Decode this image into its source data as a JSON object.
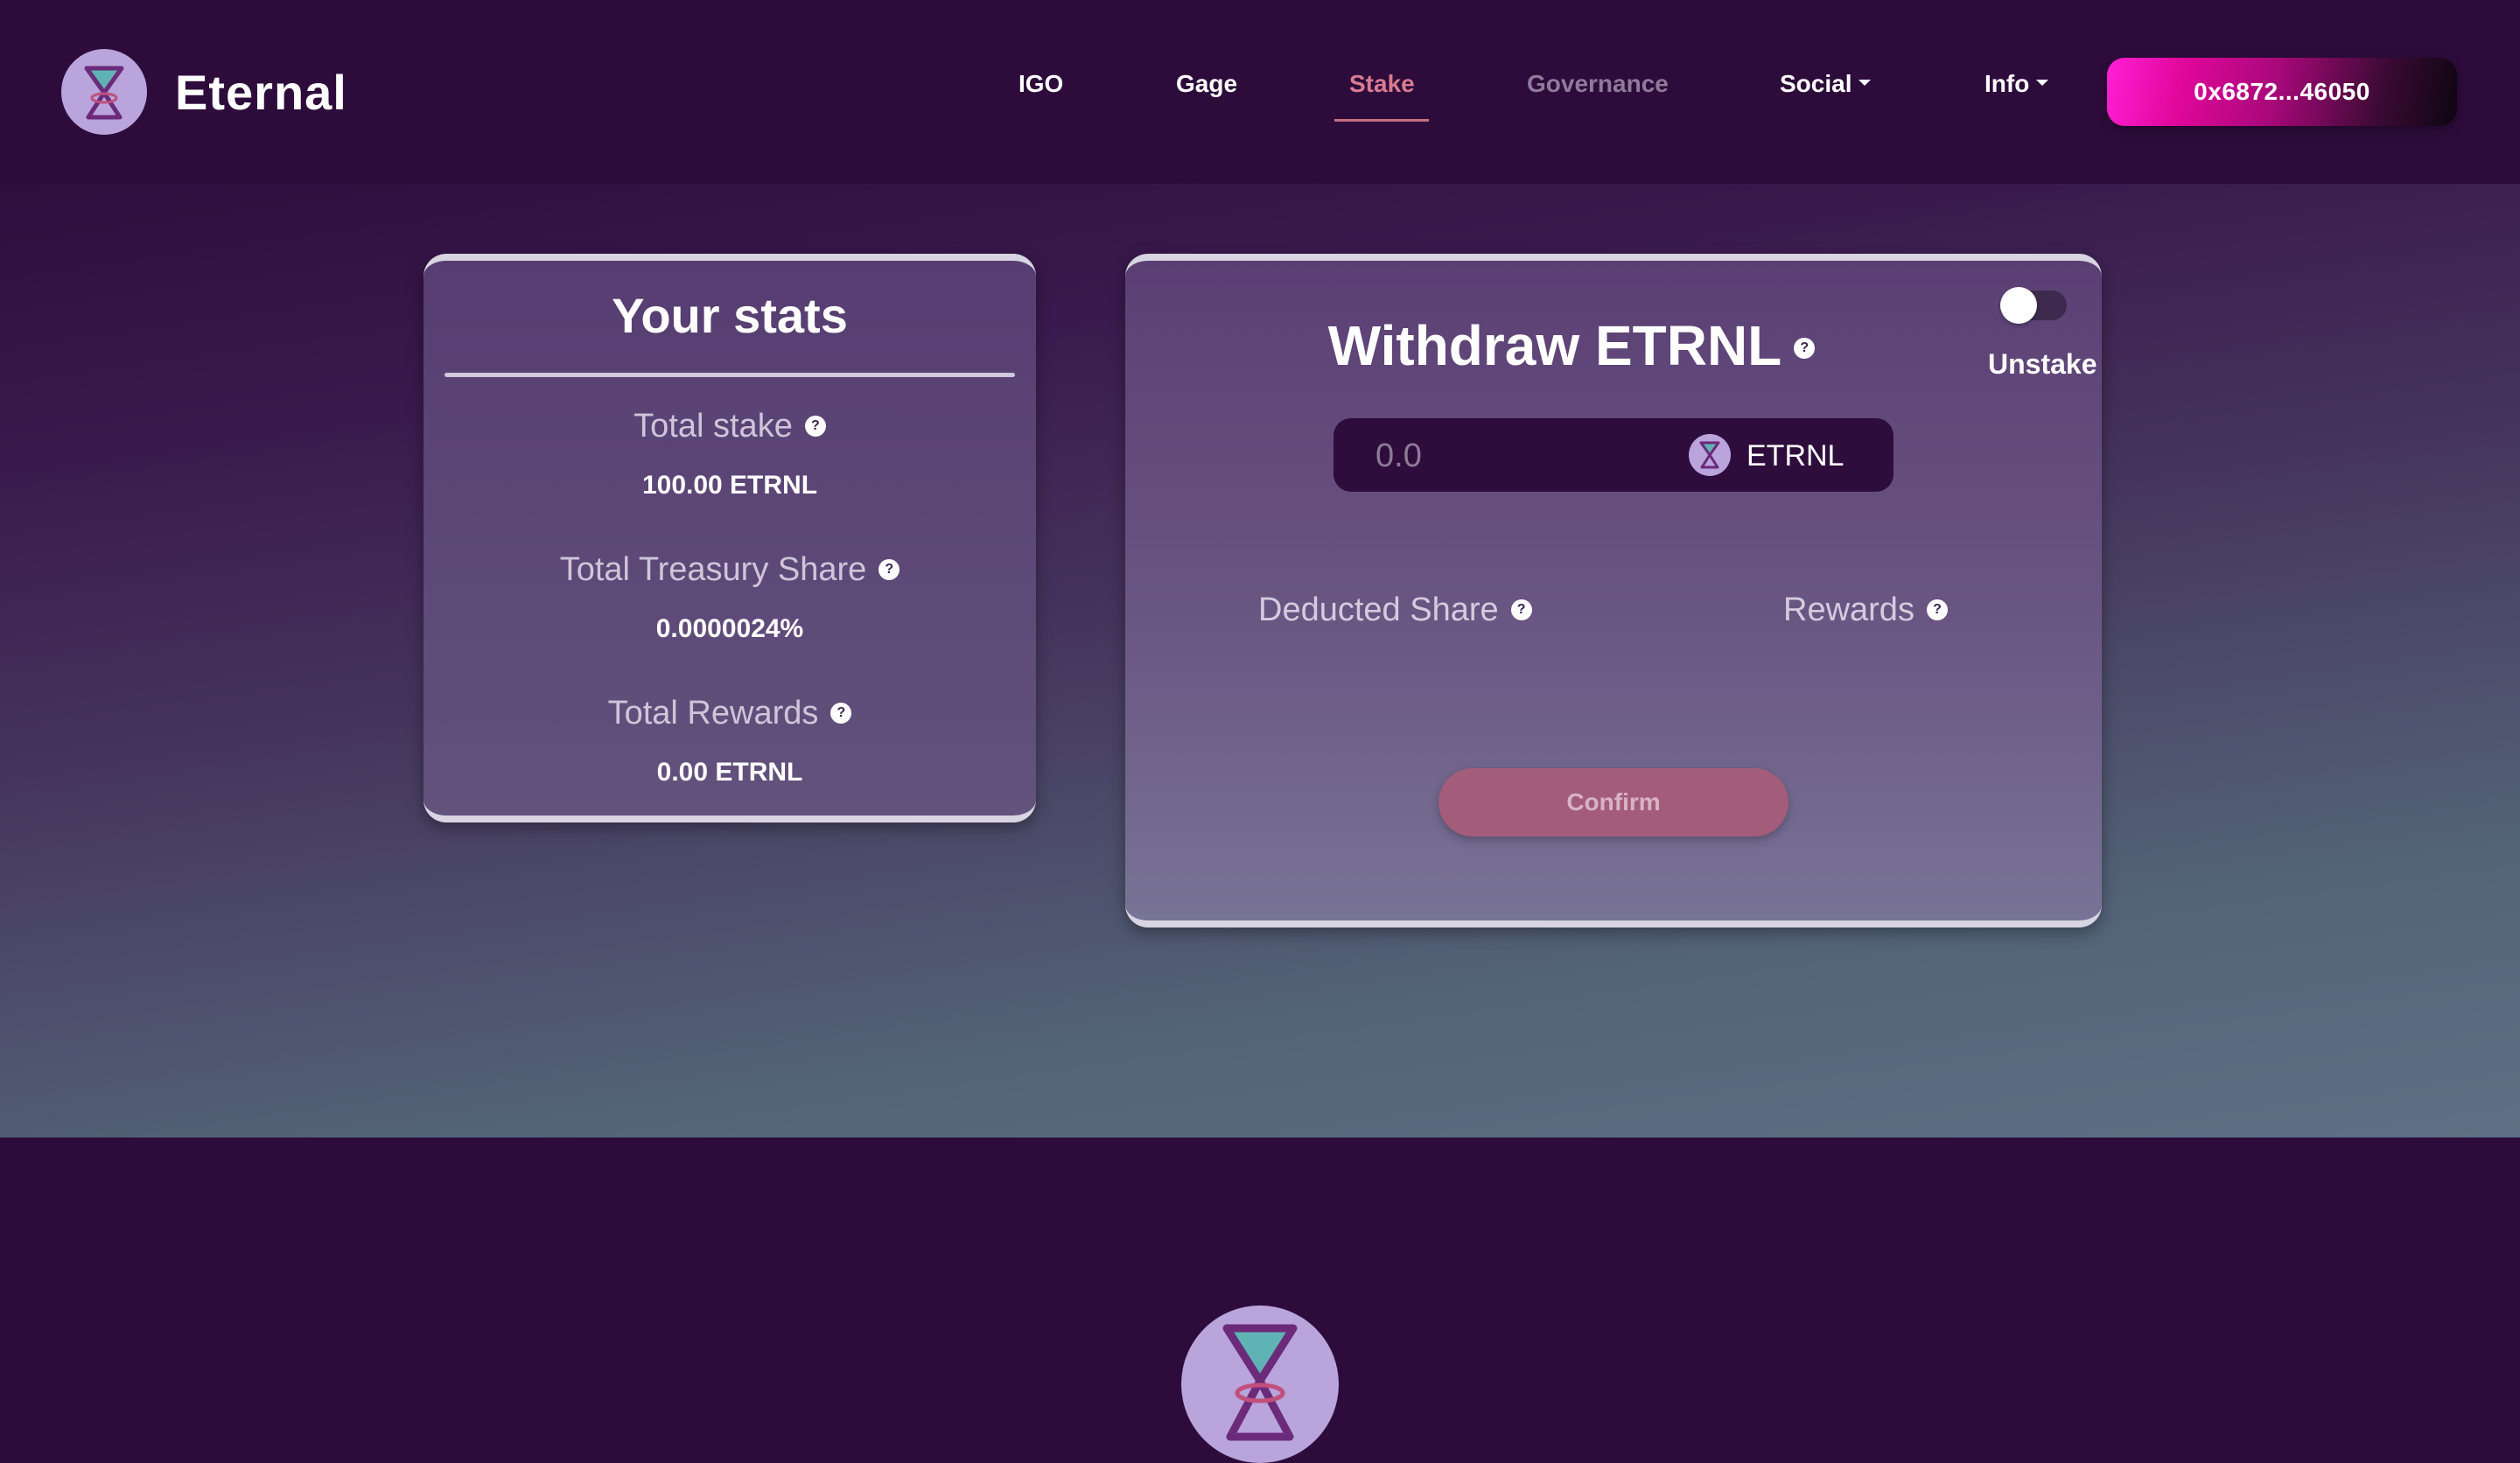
{
  "header": {
    "brand": "Eternal",
    "logo_icon": "hourglass-logo-icon",
    "nav": [
      {
        "label": "IGO"
      },
      {
        "label": "Gage"
      },
      {
        "label": "Stake",
        "active": true
      },
      {
        "label": "Governance",
        "muted": true
      },
      {
        "label": "Social",
        "has_dropdown": true
      },
      {
        "label": "Info",
        "has_dropdown": true
      }
    ],
    "wallet_address": "0x6872...46050"
  },
  "stats_card": {
    "title": "Your stats",
    "items": [
      {
        "label": "Total stake",
        "value": "100.00 ETRNL"
      },
      {
        "label": "Total Treasury Share",
        "value": "0.0000024%"
      },
      {
        "label": "Total Rewards",
        "value": "0.00 ETRNL"
      }
    ],
    "help_icon_text": "?"
  },
  "withdraw_card": {
    "title": "Withdraw ETRNL",
    "toggle_label": "Unstake",
    "toggle_on": false,
    "amount_placeholder": "0.0",
    "token_symbol": "ETRNL",
    "deducted_share_label": "Deducted Share",
    "rewards_label": "Rewards",
    "confirm_label": "Confirm"
  },
  "colors": {
    "background": "#2d0c3b",
    "accent_active_nav": "#d97a92",
    "confirm_button": "#a35c7a",
    "logo_circle": "#b9a4dc"
  }
}
